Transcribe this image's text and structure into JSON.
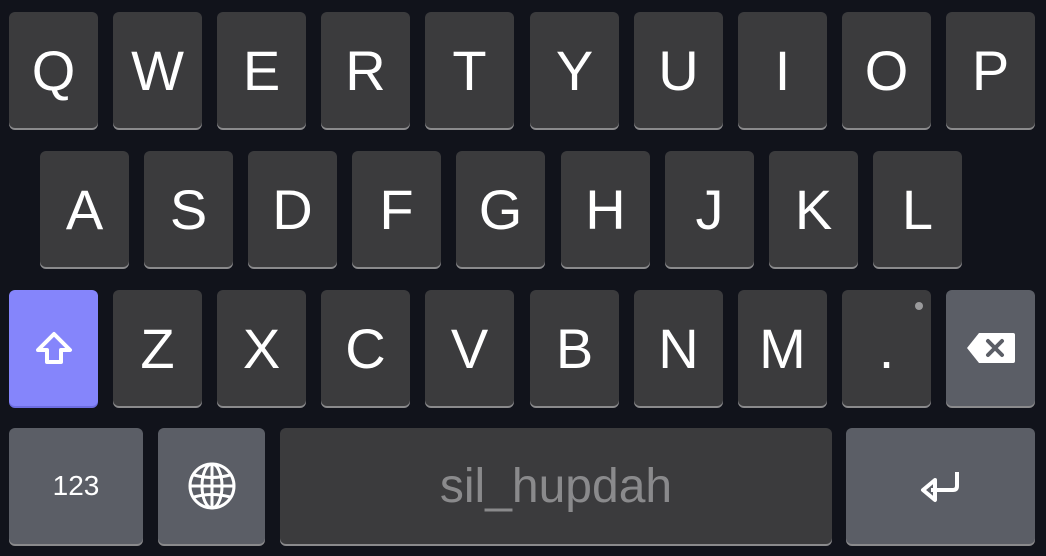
{
  "keyboard": {
    "row1": [
      "Q",
      "W",
      "E",
      "R",
      "T",
      "Y",
      "U",
      "I",
      "O",
      "P"
    ],
    "row2": [
      "A",
      "S",
      "D",
      "F",
      "G",
      "H",
      "J",
      "K",
      "L"
    ],
    "row3": [
      "Z",
      "X",
      "C",
      "V",
      "B",
      "N",
      "M"
    ],
    "period": ".",
    "numbers_label": "123",
    "space_label": "sil_hupdah",
    "icons": {
      "shift": "shift-arrow-icon",
      "backspace": "backspace-icon",
      "globe": "globe-icon",
      "enter": "enter-return-icon"
    },
    "colors": {
      "background": "#11131b",
      "key": "#3b3b3d",
      "function_key": "#5b5e66",
      "shift_active": "#8585fb",
      "space_text": "#8a8a8c"
    }
  }
}
